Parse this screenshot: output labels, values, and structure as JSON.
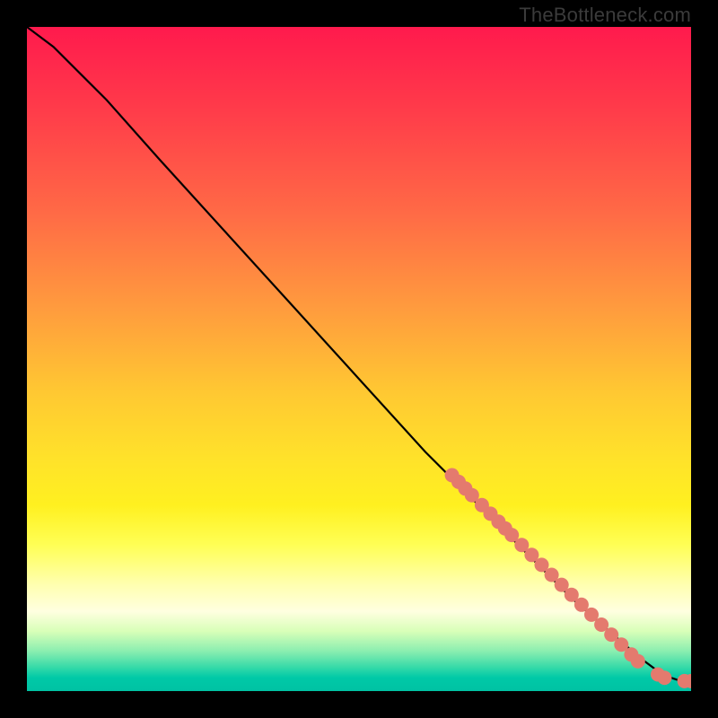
{
  "watermark": "TheBottleneck.com",
  "colors": {
    "curve": "#000000",
    "marker_fill": "#e47a6e",
    "marker_stroke": "#c95a4e"
  },
  "chart_data": {
    "type": "line",
    "title": "",
    "xlabel": "",
    "ylabel": "",
    "xlim": [
      0,
      100
    ],
    "ylim": [
      0,
      100
    ],
    "grid": false,
    "legend": false,
    "series": [
      {
        "name": "curve",
        "x": [
          0,
          4,
          8,
          12,
          20,
          30,
          40,
          50,
          60,
          66,
          70,
          74,
          78,
          82,
          86,
          90,
          93,
          95,
          97,
          98.5,
          100
        ],
        "y": [
          100,
          97,
          93,
          89,
          80,
          69,
          58,
          47,
          36,
          30,
          26,
          22,
          18,
          14,
          10.5,
          7,
          4.5,
          3,
          2,
          1.5,
          1.5
        ]
      }
    ],
    "markers": {
      "name": "highlight-dots",
      "color": "#e47a6e",
      "radius_px": 8,
      "points": [
        {
          "x": 64,
          "y": 32.5
        },
        {
          "x": 65,
          "y": 31.5
        },
        {
          "x": 66,
          "y": 30.5
        },
        {
          "x": 67,
          "y": 29.5
        },
        {
          "x": 68.5,
          "y": 28
        },
        {
          "x": 69.8,
          "y": 26.7
        },
        {
          "x": 71,
          "y": 25.5
        },
        {
          "x": 72,
          "y": 24.5
        },
        {
          "x": 73,
          "y": 23.5
        },
        {
          "x": 74.5,
          "y": 22
        },
        {
          "x": 76,
          "y": 20.5
        },
        {
          "x": 77.5,
          "y": 19
        },
        {
          "x": 79,
          "y": 17.5
        },
        {
          "x": 80.5,
          "y": 16
        },
        {
          "x": 82,
          "y": 14.5
        },
        {
          "x": 83.5,
          "y": 13
        },
        {
          "x": 85,
          "y": 11.5
        },
        {
          "x": 86.5,
          "y": 10
        },
        {
          "x": 88,
          "y": 8.5
        },
        {
          "x": 89.5,
          "y": 7
        },
        {
          "x": 91,
          "y": 5.5
        },
        {
          "x": 92,
          "y": 4.5
        },
        {
          "x": 95,
          "y": 2.5
        },
        {
          "x": 96,
          "y": 2
        },
        {
          "x": 99,
          "y": 1.5
        },
        {
          "x": 100,
          "y": 1.5
        }
      ]
    }
  }
}
